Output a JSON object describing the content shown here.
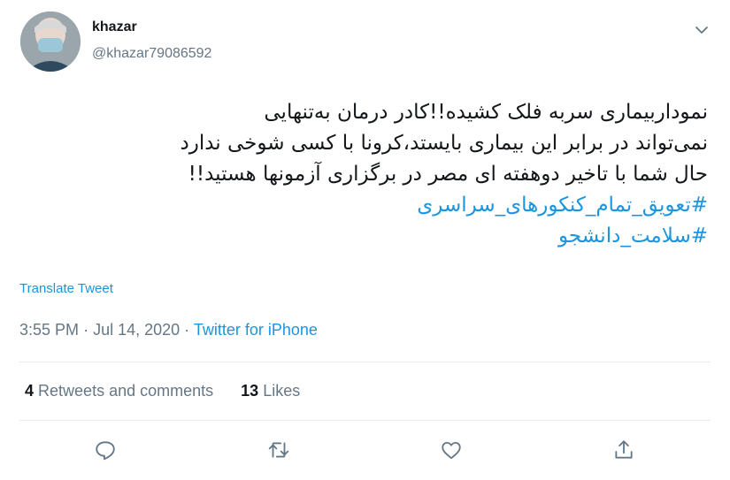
{
  "user": {
    "name": "khazar",
    "handle": "@khazar79086592"
  },
  "tweet": {
    "lines": [
      "نمودار‌بیماری سربه فلک کشیده!!کادر درمان به‌تنهایی",
      "نمی‌تواند در برابر این بیماری بایستد،کرونا با کسی شوخی ندارد",
      "حال شما با تاخیر دوهفته ای مصر در برگزاری آزمونها هستید!!"
    ],
    "hashtags": [
      "#تعویق_تمام_کنکورهای_سراسری",
      "#سلامت_دانشجو"
    ],
    "translate_label": "Translate Tweet"
  },
  "meta": {
    "time": "3:55 PM",
    "separator": "·",
    "date": "Jul 14, 2020",
    "source": "Twitter for iPhone"
  },
  "stats": {
    "retweets_count": "4",
    "retweets_label": "Retweets and comments",
    "likes_count": "13",
    "likes_label": "Likes"
  },
  "icons": {
    "more": "chevron-down-icon",
    "reply": "reply-icon",
    "retweet": "retweet-icon",
    "like": "heart-icon",
    "share": "share-icon"
  },
  "colors": {
    "link": "#1b95e0",
    "secondary": "#657786",
    "text": "#14171a"
  }
}
